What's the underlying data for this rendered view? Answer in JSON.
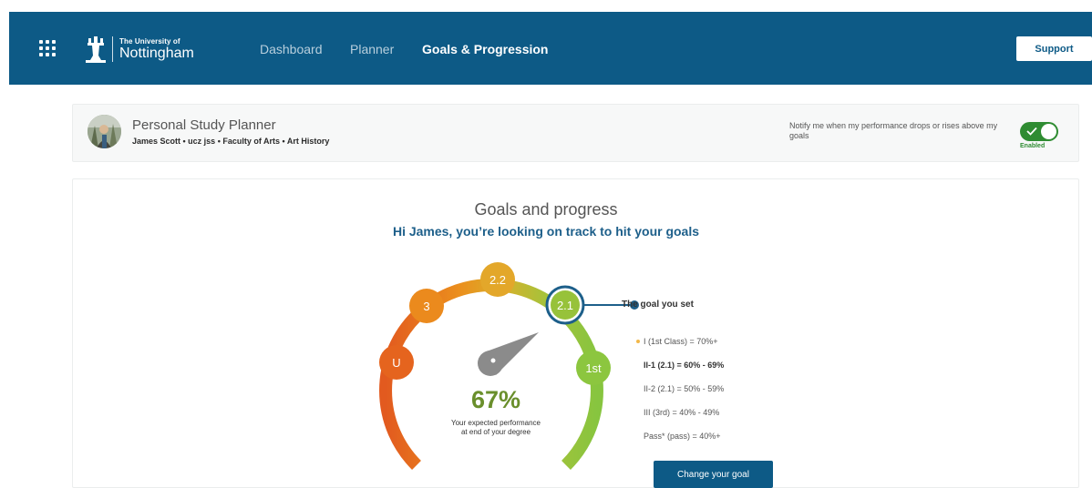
{
  "header": {
    "logo_small": "The University of",
    "logo_big": "Nottingham",
    "nav": [
      {
        "label": "Dashboard",
        "active": false
      },
      {
        "label": "Planner",
        "active": false
      },
      {
        "label": "Goals & Progression",
        "active": true
      }
    ],
    "support_label": "Support"
  },
  "profile": {
    "title": "Personal Study Planner",
    "subtitle": "James Scott • ucz jss • Faculty of Arts • Art History",
    "notify_text": "Notify me when my performance drops or rises above my goals",
    "toggle_label": "Enabled",
    "toggle_on": true
  },
  "goals": {
    "title": "Goals and progress",
    "subtitle": "Hi James, you’re looking on track to hit your goals",
    "gauge": {
      "nodes": [
        "U",
        "3",
        "2.2",
        "2.1",
        "1st"
      ],
      "selected": "2.1",
      "percentage": "67%",
      "caption_line1": "Your expected performance",
      "caption_line2": "at end of your degree"
    },
    "goal_label": "The goal you set",
    "classes": [
      {
        "text": "I (1st Class) = 70%+",
        "bold": false,
        "bullet": true
      },
      {
        "text": "II-1 (2.1) = 60% - 69%",
        "bold": true,
        "bullet": false
      },
      {
        "text": "II-2 (2.1) = 50% - 59%",
        "bold": false,
        "bullet": false
      },
      {
        "text": "III (3rd) = 40% - 49%",
        "bold": false,
        "bullet": false
      },
      {
        "text": "Pass* (pass) = 40%+",
        "bold": false,
        "bullet": false
      }
    ],
    "change_button": "Change your goal"
  },
  "colors": {
    "nav_blue": "#0d5a86",
    "toggle_green": "#2f8c32",
    "pct_green": "#6a8f2c",
    "node_u": "#e5641e",
    "node_3": "#eb8a1d",
    "node_22": "#e3a72a",
    "node_21": "#97c23a",
    "node_1st": "#8cc63f"
  }
}
